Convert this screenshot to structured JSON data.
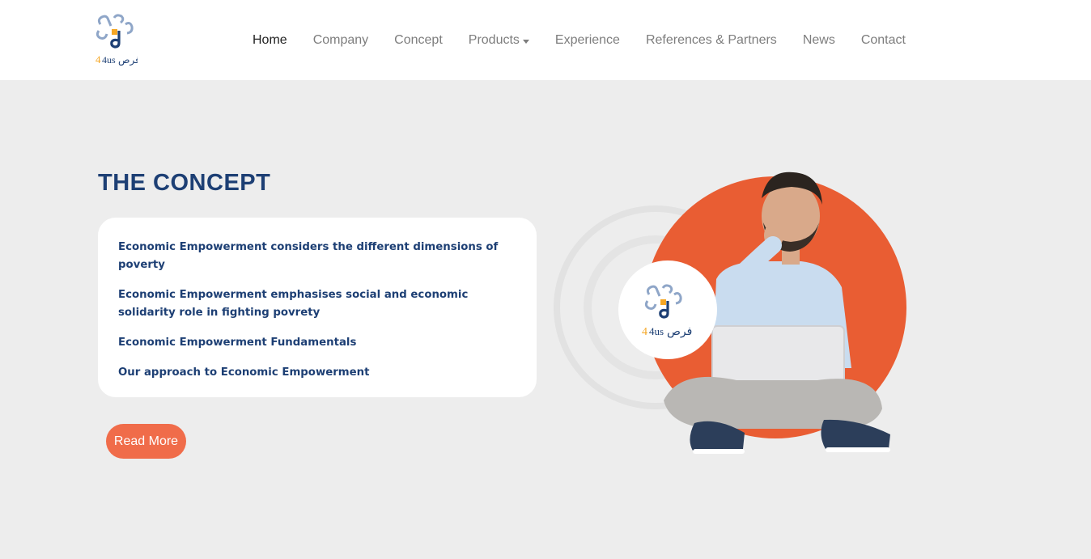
{
  "brand": {
    "logo_text": "فرص",
    "logo_suffix": "4us"
  },
  "nav": {
    "items": [
      {
        "label": "Home",
        "active": true
      },
      {
        "label": "Company"
      },
      {
        "label": "Concept"
      },
      {
        "label": "Products",
        "dropdown": true
      },
      {
        "label": "Experience"
      },
      {
        "label": "References & Partners"
      },
      {
        "label": "News"
      },
      {
        "label": "Contact"
      }
    ]
  },
  "concept": {
    "title": "THE CONCEPT",
    "items": [
      "Economic Empowerment considers the different dimensions of poverty",
      "Economic Empowerment emphasises social and economic solidarity role in fighting povrety",
      "Economic Empowerment Fundamentals",
      "Our approach to Economic Empowerment"
    ],
    "button_label": "Read More"
  },
  "colors": {
    "accent": "#f06c4a",
    "brand_blue": "#1d3f74",
    "hero_circle": "#e95d33",
    "logo_orange": "#f5a623",
    "background": "#ededed"
  }
}
